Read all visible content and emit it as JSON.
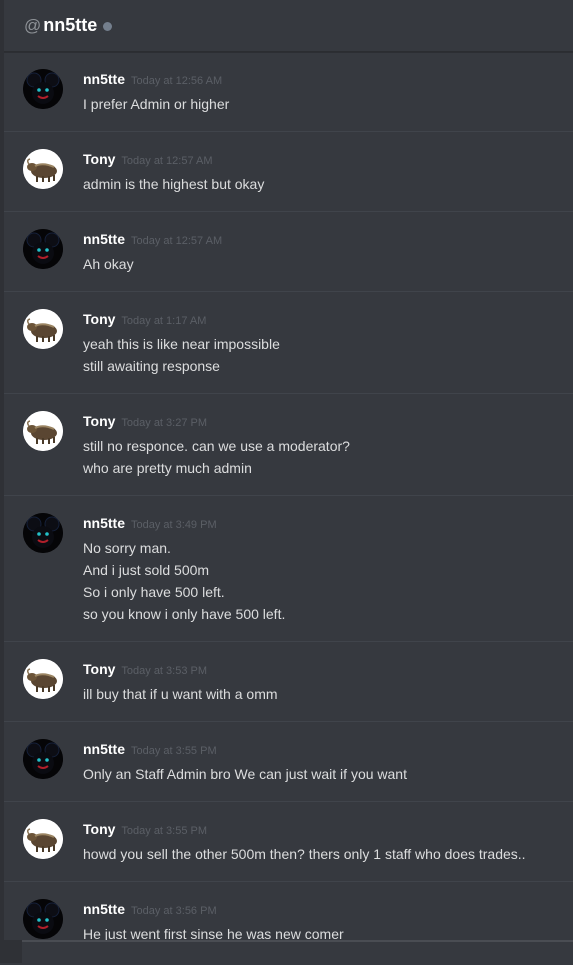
{
  "header": {
    "at_symbol": "@",
    "channel_name": "nn5tte"
  },
  "messages": [
    {
      "author": "nn5tte",
      "avatar": "nn5tte-avatar",
      "time": "Today at 12:56 AM",
      "lines": [
        "I prefer Admin or higher"
      ]
    },
    {
      "author": "Tony",
      "avatar": "tony-avatar",
      "time": "Today at 12:57 AM",
      "lines": [
        "admin is the highest but okay"
      ]
    },
    {
      "author": "nn5tte",
      "avatar": "nn5tte-avatar",
      "time": "Today at 12:57 AM",
      "lines": [
        "Ah okay"
      ]
    },
    {
      "author": "Tony",
      "avatar": "tony-avatar",
      "time": "Today at 1:17 AM",
      "lines": [
        "yeah this is like near impossible",
        "still awaiting response"
      ]
    },
    {
      "author": "Tony",
      "avatar": "tony-avatar",
      "time": "Today at 3:27 PM",
      "lines": [
        "still no responce. can we use a moderator?",
        "who are pretty much admin"
      ]
    },
    {
      "author": "nn5tte",
      "avatar": "nn5tte-avatar",
      "time": "Today at 3:49 PM",
      "lines": [
        "No sorry man.",
        "And i just sold 500m",
        "So i only have 500 left.",
        "so you know i only have 500 left."
      ]
    },
    {
      "author": "Tony",
      "avatar": "tony-avatar",
      "time": "Today at 3:53 PM",
      "lines": [
        "ill buy that if u want with a omm"
      ]
    },
    {
      "author": "nn5tte",
      "avatar": "nn5tte-avatar",
      "time": "Today at 3:55 PM",
      "lines": [
        "Only an Staff Admin bro We can just wait if you want"
      ]
    },
    {
      "author": "Tony",
      "avatar": "tony-avatar",
      "time": "Today at 3:55 PM",
      "lines": [
        "howd you sell the other 500m then? thers only 1 staff who does trades.."
      ]
    },
    {
      "author": "nn5tte",
      "avatar": "nn5tte-avatar",
      "time": "Today at 3:56 PM",
      "lines": [
        "He just went first sinse he was new comer"
      ]
    }
  ]
}
